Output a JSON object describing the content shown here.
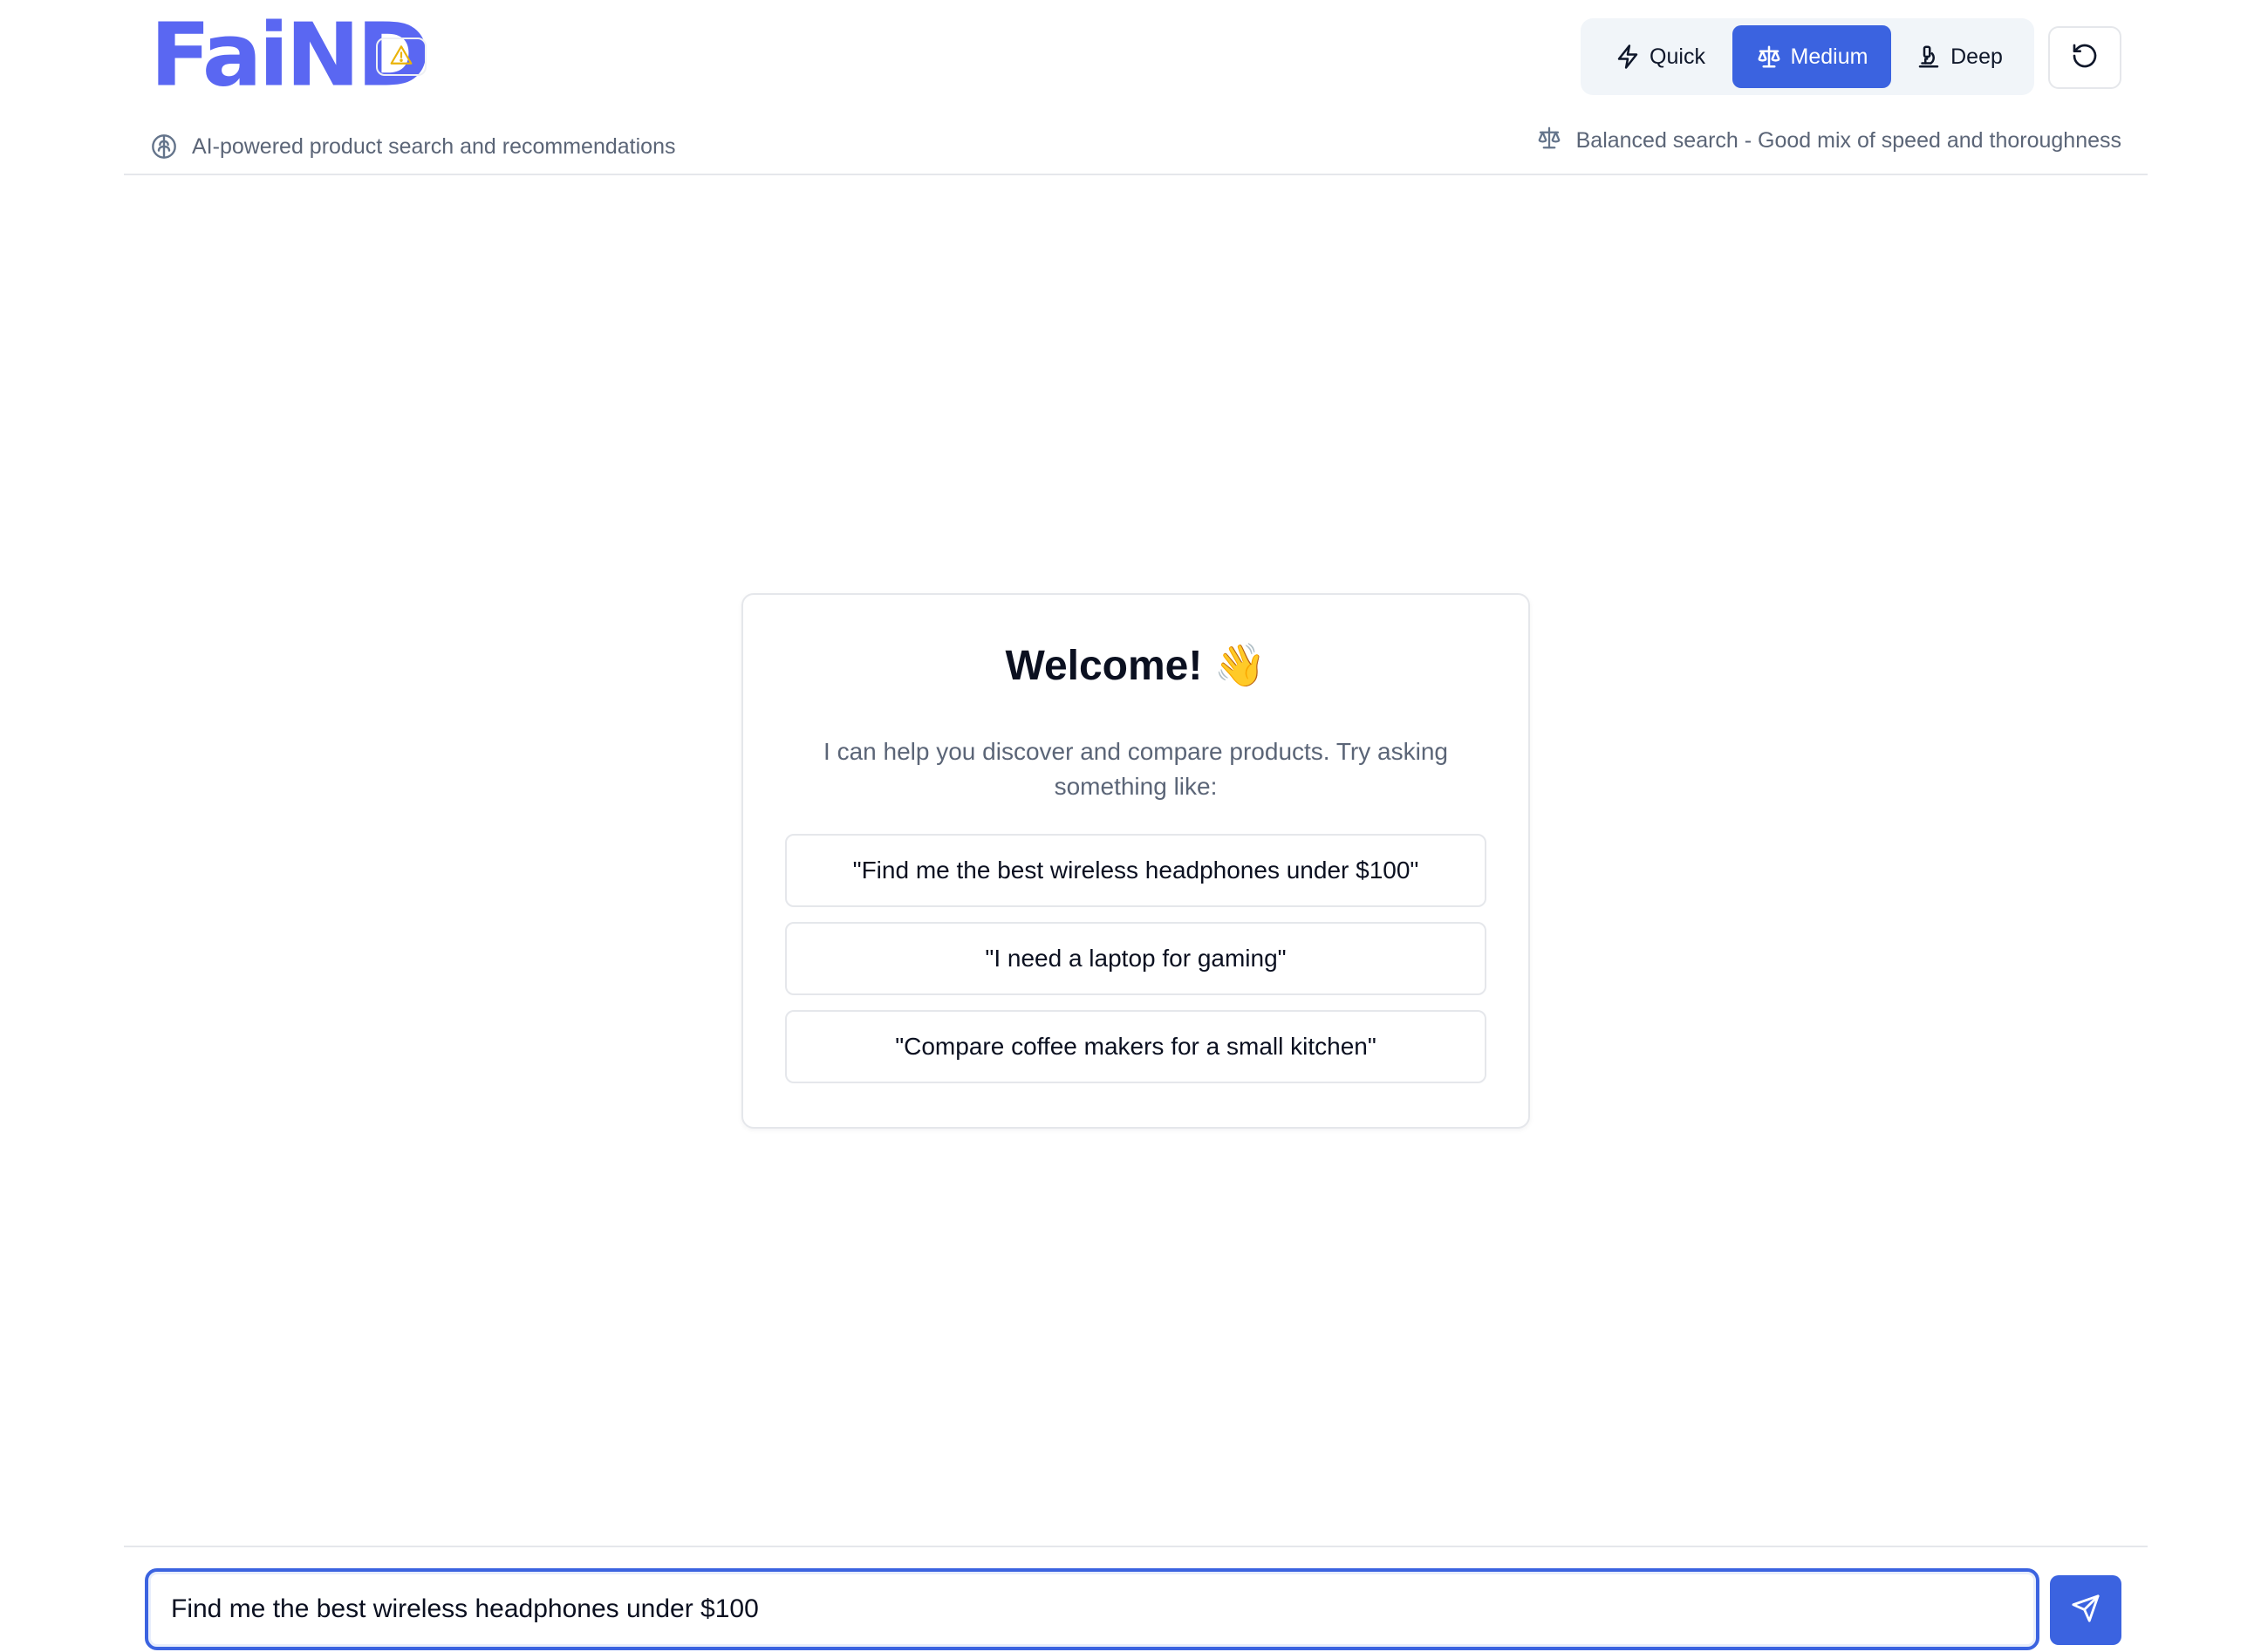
{
  "app": {
    "logo_text": "FaiND",
    "tagline": "AI-powered product search and recommendations"
  },
  "header": {
    "warning_icon": "warning-triangle-icon",
    "modes": [
      {
        "id": "quick",
        "label": "Quick",
        "icon": "lightning-icon",
        "selected": false
      },
      {
        "id": "medium",
        "label": "Medium",
        "icon": "scale-icon",
        "selected": true
      },
      {
        "id": "deep",
        "label": "Deep",
        "icon": "microscope-icon",
        "selected": false
      }
    ],
    "reset_icon": "rotate-ccw-icon",
    "mode_description": "Balanced search - Good mix of speed and thoroughness"
  },
  "welcome": {
    "title": "Welcome!",
    "emoji": "👋",
    "intro": "I can help you discover and compare products. Try asking something like:",
    "suggestions": [
      "\"Find me the best wireless headphones under $100\"",
      "\"I need a laptop for gaming\"",
      "\"Compare coffee makers for a small kitchen\""
    ]
  },
  "input": {
    "value": "Find me the best wireless headphones under $100",
    "send_icon": "send-icon"
  },
  "colors": {
    "accent": "#3b63e0",
    "logo": "#5a67f2",
    "warning": "#eab308",
    "muted_text": "#5b6577"
  }
}
